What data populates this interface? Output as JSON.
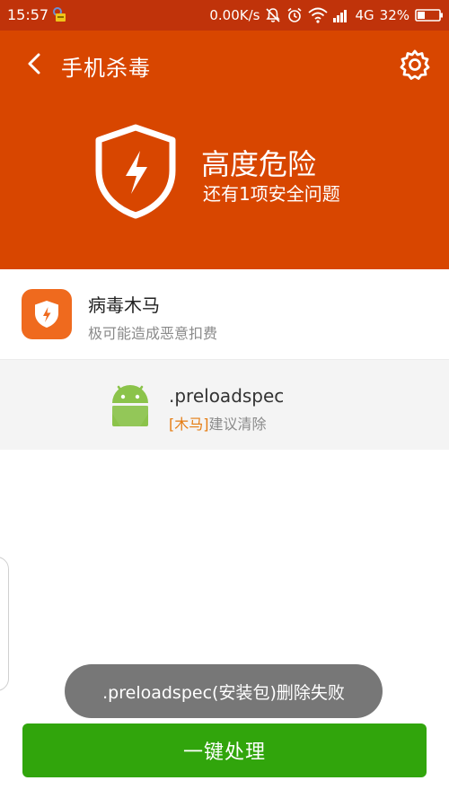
{
  "status_bar": {
    "time": "15:57",
    "net_speed": "0.00K/s",
    "network_type": "4G",
    "battery": "32%",
    "icons": [
      "app-notification-icon",
      "mute-bell-icon",
      "alarm-icon",
      "wifi-icon",
      "signal-icon",
      "battery-icon"
    ]
  },
  "header": {
    "title": "手机杀毒",
    "status_title": "高度危险",
    "status_sub": "还有1项安全问题",
    "icons": [
      "back-arrow-icon",
      "settings-gear-icon",
      "shield-bolt-icon"
    ]
  },
  "category": {
    "title": "病毒木马",
    "subtitle": "极可能造成恶意扣费",
    "icon": "shield-bolt-icon"
  },
  "item": {
    "name": ".preloadspec",
    "tag": "[木马]",
    "desc": "建议清除",
    "icon": "android-icon"
  },
  "toast": {
    "text": ".preloadspec(安装包)删除失败"
  },
  "action_button": {
    "label": "一键处理"
  },
  "colors": {
    "status_bar": "#c0330a",
    "header": "#d84600",
    "category_icon": "#ef6a1e",
    "tag": "#e57c12",
    "button": "#31a50c",
    "toast": "#777777"
  }
}
